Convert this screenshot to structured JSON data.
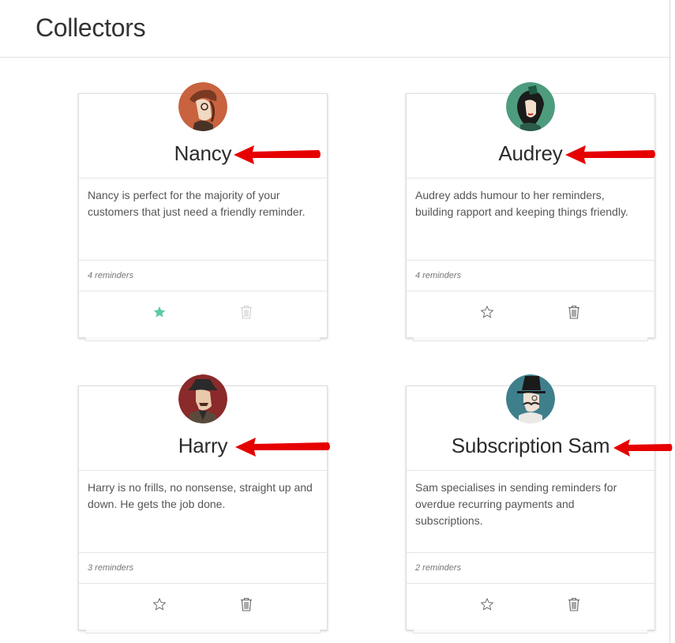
{
  "header": {
    "title": "Collectors"
  },
  "colors": {
    "accent": "#5cc9a7",
    "arrow": "#e60000",
    "icon_muted": "#cfcfcf",
    "icon": "#666666"
  },
  "cards": [
    {
      "name": "Nancy",
      "description": "Nancy is perfect for the majority of your customers that just need a friendly reminder.",
      "count": "4 reminders",
      "favorite": true,
      "avatar_icon": "nancy-avatar"
    },
    {
      "name": "Audrey",
      "description": "Audrey adds humour to her reminders, building rapport and keeping things friendly.",
      "count": "4 reminders",
      "favorite": false,
      "avatar_icon": "audrey-avatar"
    },
    {
      "name": "Harry",
      "description": "Harry is no frills, no nonsense, straight up and down. He gets the job done.",
      "count": "3 reminders",
      "favorite": false,
      "avatar_icon": "harry-avatar"
    },
    {
      "name": "Subscription Sam",
      "description": "Sam specialises in sending reminders for overdue recurring payments and subscriptions.",
      "count": "2 reminders",
      "favorite": false,
      "avatar_icon": "sam-avatar"
    }
  ]
}
